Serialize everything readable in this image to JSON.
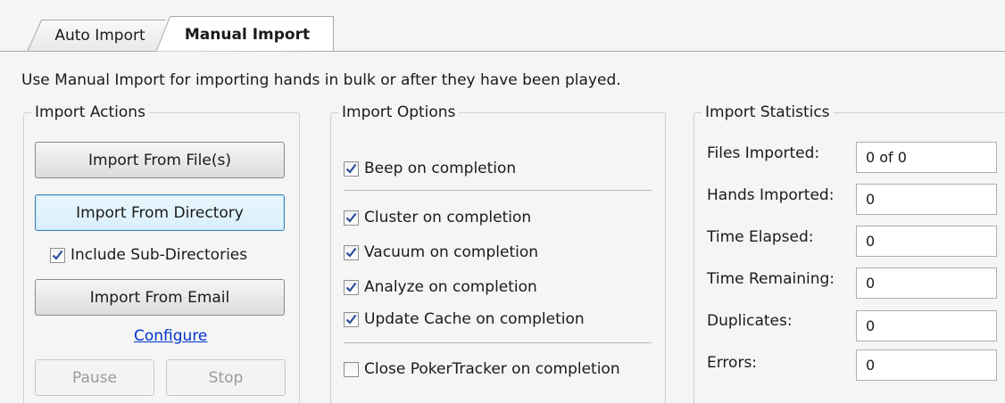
{
  "tabs": {
    "auto": "Auto Import",
    "manual": "Manual Import"
  },
  "description": "Use Manual Import for importing hands in bulk or after they have been played.",
  "actions": {
    "legend": "Import Actions",
    "import_files": "Import From File(s)",
    "import_directory": "Import From Directory",
    "include_subdirs": "Include Sub-Directories",
    "include_subdirs_checked": true,
    "import_email": "Import From Email",
    "configure": "Configure",
    "pause": "Pause",
    "stop": "Stop"
  },
  "options": {
    "legend": "Import Options",
    "items": [
      {
        "label": "Beep on completion",
        "checked": true
      },
      {
        "label": "Cluster on completion",
        "checked": true
      },
      {
        "label": "Vacuum on completion",
        "checked": true
      },
      {
        "label": "Analyze on completion",
        "checked": true
      },
      {
        "label": "Update Cache on completion",
        "checked": true
      },
      {
        "label": "Close PokerTracker on completion",
        "checked": false
      }
    ]
  },
  "statistics": {
    "legend": "Import Statistics",
    "rows": [
      {
        "label": "Files Imported:",
        "value": "0 of 0"
      },
      {
        "label": "Hands Imported:",
        "value": "0"
      },
      {
        "label": "Time Elapsed:",
        "value": "0"
      },
      {
        "label": "Time Remaining:",
        "value": "0"
      },
      {
        "label": "Duplicates:",
        "value": "0"
      },
      {
        "label": "Errors:",
        "value": "0"
      }
    ]
  },
  "colors": {
    "accent_focus": "#3c7fb1",
    "link": "#0033cc",
    "check": "#2b4f99"
  }
}
